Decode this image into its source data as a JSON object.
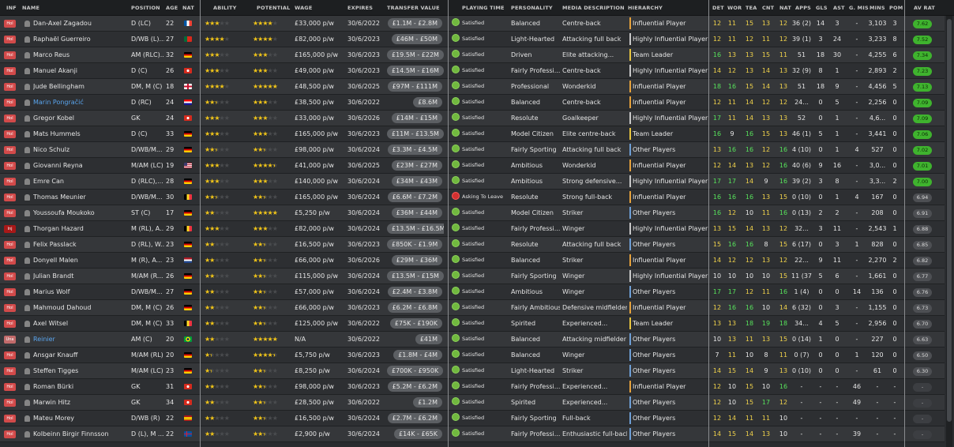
{
  "columns": {
    "inf": "INF",
    "name": "NAME",
    "position": "POSITION",
    "age": "AGE",
    "nat": "NAT",
    "ability": "ABILITY",
    "potential": "POTENTIAL",
    "wage": "WAGE",
    "expires": "EXPIRES",
    "transfer_value": "TRANSFER VALUE",
    "playing_time": "PLAYING TIME",
    "personality": "PERSONALITY",
    "media": "MEDIA DESCRIPTION",
    "hierarchy": "HIERARCHY",
    "det": "DET",
    "wor": "WOR",
    "tea": "TEA",
    "cnt": "CNT",
    "nat2": "NAT",
    "apps": "APPS",
    "gls": "GLS",
    "ast": "AST",
    "gmis": "G. MIS",
    "mins": "MINS",
    "pom": "POM",
    "avrat": "AV RAT"
  },
  "colors": {
    "ratingHigh": "#3fb32e",
    "stars": "#f0c419",
    "satisfied": "#71b83f",
    "unhappy": "#d23030",
    "infTag": "#d24a4a",
    "link": "#5aa5ee"
  },
  "players": [
    {
      "inf": "Hol",
      "name": "Dan-Axel Zagadou",
      "pos": "D (LC)",
      "age": "22",
      "flag": "fr",
      "ab": 3,
      "pot": 4,
      "wage": "£33,000 p/w",
      "exp": "30/6/2022",
      "tv": "£1.1M - £2.8M",
      "pt": "Satisfied",
      "pers": "Balanced",
      "media": "Centre-back",
      "hier": "Influential Player",
      "det": "12",
      "wor": "11",
      "tea": "15",
      "cnt": "13",
      "nat": "12",
      "apps": "36 (2)",
      "gls": "14",
      "ast": "3",
      "gmis": "-",
      "mins": "3,103",
      "pom": "3",
      "rat": "7.62",
      "rc": "h"
    },
    {
      "inf": "Hol",
      "name": "Raphaël Guerreiro",
      "pos": "D/WB (L)...",
      "age": "27",
      "flag": "pt",
      "ab": 4,
      "pot": 4,
      "wage": "£82,000 p/w",
      "exp": "30/6/2023",
      "tv": "£46M - £50M",
      "pt": "Satisfied",
      "pers": "Light-Hearted",
      "media": "Attacking full back",
      "hier": "Highly Influential Player",
      "det": "12",
      "wor": "11",
      "tea": "12",
      "cnt": "11",
      "nat": "12",
      "apps": "39 (1)",
      "gls": "3",
      "ast": "24",
      "gmis": "-",
      "mins": "3,233",
      "pom": "8",
      "rat": "7.52",
      "rc": "h"
    },
    {
      "inf": "Hol",
      "name": "Marco Reus",
      "pos": "AM (RLC)...",
      "age": "32",
      "flag": "de",
      "ab": 3,
      "pot": 3,
      "wage": "£165,000 p/w",
      "exp": "30/6/2023",
      "tv": "£19.5M - £22M",
      "pt": "Satisfied",
      "pers": "Driven",
      "media": "Elite attacking...",
      "hier": "Team Leader",
      "det": "16",
      "wor": "13",
      "tea": "13",
      "cnt": "15",
      "nat": "11",
      "apps": "51",
      "gls": "18",
      "ast": "30",
      "gmis": "-",
      "mins": "4,255",
      "pom": "6",
      "rat": "7.34",
      "rc": "h"
    },
    {
      "inf": "Hol",
      "name": "Manuel Akanji",
      "pos": "D (C)",
      "age": "26",
      "flag": "ch",
      "ab": 3,
      "pot": 3,
      "wage": "£49,000 p/w",
      "exp": "30/6/2023",
      "tv": "£14.5M - £16M",
      "pt": "Satisfied",
      "pers": "Fairly Professi...",
      "media": "Centre-back",
      "hier": "Highly Influential Player",
      "det": "14",
      "wor": "12",
      "tea": "13",
      "cnt": "14",
      "nat": "13",
      "apps": "32 (9)",
      "gls": "8",
      "ast": "1",
      "gmis": "-",
      "mins": "2,893",
      "pom": "2",
      "rat": "7.23",
      "rc": "h"
    },
    {
      "inf": "Hol",
      "name": "Jude Bellingham",
      "pos": "DM, M (C)",
      "age": "18",
      "flag": "gb",
      "ab": 4,
      "pot": 5,
      "wage": "£48,500 p/w",
      "exp": "30/6/2025",
      "tv": "£97M - £111M",
      "pt": "Satisfied",
      "pers": "Professional",
      "media": "Wonderkid",
      "hier": "Influential Player",
      "det": "18",
      "wor": "16",
      "tea": "15",
      "cnt": "14",
      "nat": "13",
      "apps": "51",
      "gls": "18",
      "ast": "9",
      "gmis": "-",
      "mins": "4,456",
      "pom": "5",
      "rat": "7.13",
      "rc": "h"
    },
    {
      "inf": "Hol",
      "name": "Marin Pongračić",
      "pos": "D (RC)",
      "age": "24",
      "flag": "hr",
      "ab": 2.5,
      "pot": 3,
      "wage": "£38,500 p/w",
      "exp": "30/6/2022",
      "tv": "£8.6M",
      "pt": "Satisfied",
      "pers": "Balanced",
      "media": "Centre-back",
      "hier": "Influential Player",
      "det": "12",
      "wor": "11",
      "tea": "14",
      "cnt": "12",
      "nat": "12",
      "apps": "24...",
      "gls": "0",
      "ast": "5",
      "gmis": "-",
      "mins": "2,256",
      "pom": "0",
      "rat": "7.09",
      "rc": "h",
      "link": true
    },
    {
      "inf": "Hol",
      "name": "Gregor Kobel",
      "pos": "GK",
      "age": "24",
      "flag": "ch",
      "ab": 3,
      "pot": 3,
      "wage": "£33,000 p/w",
      "exp": "30/6/2026",
      "tv": "£14M - £15M",
      "pt": "Satisfied",
      "pers": "Resolute",
      "media": "Goalkeeper",
      "hier": "Highly Influential Player",
      "det": "17",
      "wor": "11",
      "tea": "14",
      "cnt": "13",
      "nat": "13",
      "apps": "52",
      "gls": "0",
      "ast": "1",
      "gmis": "-",
      "mins": "4,6...",
      "pom": "0",
      "rat": "7.09",
      "rc": "h"
    },
    {
      "inf": "Hol",
      "name": "Mats Hummels",
      "pos": "D (C)",
      "age": "33",
      "flag": "de",
      "ab": 3,
      "pot": 3,
      "wage": "£165,000 p/w",
      "exp": "30/6/2023",
      "tv": "£11M - £13.5M",
      "pt": "Satisfied",
      "pers": "Model Citizen",
      "media": "Elite centre-back",
      "hier": "Team Leader",
      "det": "16",
      "wor": "9",
      "tea": "16",
      "cnt": "15",
      "nat": "13",
      "apps": "46 (1)",
      "gls": "5",
      "ast": "1",
      "gmis": "-",
      "mins": "3,441",
      "pom": "0",
      "rat": "7.06",
      "rc": "h"
    },
    {
      "inf": "Hol",
      "name": "Nico Schulz",
      "pos": "D/WB/M...",
      "age": "29",
      "flag": "de",
      "ab": 2.5,
      "pot": 2.5,
      "wage": "£98,000 p/w",
      "exp": "30/6/2024",
      "tv": "£3.3M - £4.5M",
      "pt": "Satisfied",
      "pers": "Fairly Sporting",
      "media": "Attacking full back",
      "hier": "Other Players",
      "det": "13",
      "wor": "16",
      "tea": "16",
      "cnt": "12",
      "nat": "16",
      "apps": "4 (10)",
      "gls": "0",
      "ast": "1",
      "gmis": "4",
      "mins": "527",
      "pom": "0",
      "rat": "7.02",
      "rc": "h"
    },
    {
      "inf": "Hol",
      "name": "Giovanni Reyna",
      "pos": "M/AM (LC)",
      "age": "19",
      "flag": "us",
      "ab": 3,
      "pot": 4.5,
      "wage": "£41,000 p/w",
      "exp": "30/6/2025",
      "tv": "£23M - £27M",
      "pt": "Satisfied",
      "pers": "Ambitious",
      "media": "Wonderkid",
      "hier": "Influential Player",
      "det": "12",
      "wor": "14",
      "tea": "13",
      "cnt": "12",
      "nat": "16",
      "apps": "40 (6)",
      "gls": "9",
      "ast": "16",
      "gmis": "-",
      "mins": "3,0...",
      "pom": "0",
      "rat": "7.01",
      "rc": "h"
    },
    {
      "inf": "Hol",
      "name": "Emre Can",
      "pos": "D (RLC),...",
      "age": "28",
      "flag": "de",
      "ab": 3,
      "pot": 3,
      "wage": "£140,000 p/w",
      "exp": "30/6/2024",
      "tv": "£34M - £43M",
      "pt": "Satisfied",
      "pers": "Ambitious",
      "media": "Strong defensive...",
      "hier": "Highly Influential Player",
      "det": "17",
      "wor": "17",
      "tea": "14",
      "cnt": "9",
      "nat": "16",
      "apps": "39 (2)",
      "gls": "3",
      "ast": "8",
      "gmis": "-",
      "mins": "3,3...",
      "pom": "2",
      "rat": "7.00",
      "rc": "h"
    },
    {
      "inf": "Hol",
      "name": "Thomas Meunier",
      "pos": "D/WB/M...",
      "age": "30",
      "flag": "be",
      "ab": 2.5,
      "pot": 2.5,
      "wage": "£165,000 p/w",
      "exp": "30/6/2024",
      "tv": "£6.6M - £7.2M",
      "pt": "Asking To Leave",
      "bad": true,
      "pers": "Resolute",
      "media": "Strong full-back",
      "hier": "Influential Player",
      "det": "16",
      "wor": "16",
      "tea": "16",
      "cnt": "13",
      "nat": "15",
      "apps": "0 (10)",
      "gls": "0",
      "ast": "1",
      "gmis": "4",
      "mins": "167",
      "pom": "0",
      "rat": "6.94",
      "rc": "m"
    },
    {
      "inf": "Hol",
      "name": "Youssoufa Moukoko",
      "pos": "ST (C)",
      "age": "17",
      "flag": "de",
      "ab": 2,
      "pot": 5,
      "wage": "£5,250 p/w",
      "exp": "30/6/2024",
      "tv": "£36M - £44M",
      "pt": "Satisfied",
      "pers": "Model Citizen",
      "media": "Striker",
      "hier": "Other Players",
      "det": "16",
      "wor": "12",
      "tea": "10",
      "cnt": "11",
      "nat": "16",
      "apps": "0 (13)",
      "gls": "2",
      "ast": "2",
      "gmis": "-",
      "mins": "208",
      "pom": "0",
      "rat": "6.91",
      "rc": "m"
    },
    {
      "inf": "Inj",
      "name": "Thorgan Hazard",
      "pos": "M (RL), A...",
      "age": "29",
      "flag": "be",
      "ab": 3,
      "pot": 3,
      "wage": "£82,000 p/w",
      "exp": "30/6/2024",
      "tv": "£13.5M - £16.5M",
      "pt": "Satisfied",
      "pers": "Fairly Professi...",
      "media": "Winger",
      "hier": "Highly Influential Player",
      "det": "13",
      "wor": "15",
      "tea": "14",
      "cnt": "13",
      "nat": "12",
      "apps": "32...",
      "gls": "3",
      "ast": "11",
      "gmis": "-",
      "mins": "2,543",
      "pom": "1",
      "rat": "6.88",
      "rc": "m"
    },
    {
      "inf": "Hol",
      "name": "Felix Passlack",
      "pos": "D (RL), W...",
      "age": "23",
      "flag": "de",
      "ab": 2,
      "pot": 2.5,
      "wage": "£16,500 p/w",
      "exp": "30/6/2023",
      "tv": "£850K - £1.9M",
      "pt": "Satisfied",
      "pers": "Resolute",
      "media": "Attacking full back",
      "hier": "Other Players",
      "det": "15",
      "wor": "16",
      "tea": "16",
      "cnt": "8",
      "nat": "15",
      "apps": "6 (17)",
      "gls": "0",
      "ast": "3",
      "gmis": "1",
      "mins": "828",
      "pom": "0",
      "rat": "6.85",
      "rc": "m"
    },
    {
      "inf": "Hol",
      "name": "Donyell Malen",
      "pos": "M (R), A...",
      "age": "23",
      "flag": "nl",
      "ab": 2,
      "pot": 2.5,
      "wage": "£66,000 p/w",
      "exp": "30/6/2026",
      "tv": "£29M - £36M",
      "pt": "Satisfied",
      "pers": "Balanced",
      "media": "Striker",
      "hier": "Influential Player",
      "det": "14",
      "wor": "12",
      "tea": "12",
      "cnt": "13",
      "nat": "12",
      "apps": "22...",
      "gls": "9",
      "ast": "11",
      "gmis": "-",
      "mins": "2,270",
      "pom": "2",
      "rat": "6.82",
      "rc": "m"
    },
    {
      "inf": "Hol",
      "name": "Julian Brandt",
      "pos": "M/AM (R...",
      "age": "26",
      "flag": "de",
      "ab": 2,
      "pot": 2.5,
      "wage": "£115,000 p/w",
      "exp": "30/6/2024",
      "tv": "£13.5M - £15M",
      "pt": "Satisfied",
      "pers": "Fairly Sporting",
      "media": "Winger",
      "hier": "Highly Influential Player",
      "det": "10",
      "wor": "10",
      "tea": "10",
      "cnt": "10",
      "nat": "15",
      "apps": "11 (37)",
      "gls": "5",
      "ast": "6",
      "gmis": "-",
      "mins": "1,661",
      "pom": "0",
      "rat": "6.77",
      "rc": "m"
    },
    {
      "inf": "Hol",
      "name": "Marius Wolf",
      "pos": "D/WB/M...",
      "age": "27",
      "flag": "de",
      "ab": 2,
      "pot": 2.5,
      "wage": "£57,000 p/w",
      "exp": "30/6/2024",
      "tv": "£2.4M - £3.8M",
      "pt": "Satisfied",
      "pers": "Ambitious",
      "media": "Winger",
      "hier": "Other Players",
      "det": "17",
      "wor": "17",
      "tea": "12",
      "cnt": "11",
      "nat": "16",
      "apps": "1 (4)",
      "gls": "0",
      "ast": "0",
      "gmis": "14",
      "mins": "136",
      "pom": "0",
      "rat": "6.76",
      "rc": "m"
    },
    {
      "inf": "Hol",
      "name": "Mahmoud Dahoud",
      "pos": "DM, M (C)",
      "age": "26",
      "flag": "de",
      "ab": 2,
      "pot": 2.5,
      "wage": "£66,000 p/w",
      "exp": "30/6/2023",
      "tv": "£6.2M - £6.8M",
      "pt": "Satisfied",
      "pers": "Fairly Ambitious",
      "media": "Defensive midfielder",
      "hier": "Influential Player",
      "det": "12",
      "wor": "16",
      "tea": "16",
      "cnt": "10",
      "nat": "14",
      "apps": "6 (32)",
      "gls": "0",
      "ast": "3",
      "gmis": "-",
      "mins": "1,155",
      "pom": "0",
      "rat": "6.73",
      "rc": "m"
    },
    {
      "inf": "Hol",
      "name": "Axel Witsel",
      "pos": "DM, M (C)",
      "age": "33",
      "flag": "be",
      "ab": 2,
      "pot": 2.5,
      "wage": "£125,000 p/w",
      "exp": "30/6/2022",
      "tv": "£75K - £190K",
      "pt": "Satisfied",
      "pers": "Spirited",
      "media": "Experienced...",
      "hier": "Team Leader",
      "det": "13",
      "wor": "13",
      "tea": "18",
      "cnt": "19",
      "nat": "18",
      "apps": "34...",
      "gls": "4",
      "ast": "5",
      "gmis": "-",
      "mins": "2,956",
      "pom": "0",
      "rat": "6.70",
      "rc": "m"
    },
    {
      "inf": "Una",
      "name": "Reinier",
      "pos": "AM (C)",
      "age": "20",
      "flag": "br",
      "ab": 2,
      "pot": 5,
      "wage": "N/A",
      "exp": "30/6/2022",
      "tv": "£41M",
      "pt": "Satisfied",
      "pers": "Balanced",
      "media": "Attacking midfielder",
      "hier": "Other Players",
      "det": "10",
      "wor": "13",
      "tea": "11",
      "cnt": "13",
      "nat": "15",
      "apps": "0 (14)",
      "gls": "1",
      "ast": "0",
      "gmis": "-",
      "mins": "227",
      "pom": "0",
      "rat": "6.63",
      "rc": "m",
      "link": true
    },
    {
      "inf": "Hol",
      "name": "Ansgar Knauff",
      "pos": "M/AM (RL)",
      "age": "20",
      "flag": "de",
      "ab": 1.5,
      "pot": 4.5,
      "wage": "£5,750 p/w",
      "exp": "30/6/2023",
      "tv": "£1.8M - £4M",
      "pt": "Satisfied",
      "pers": "Balanced",
      "media": "Winger",
      "hier": "Other Players",
      "det": "7",
      "wor": "11",
      "tea": "10",
      "cnt": "8",
      "nat": "11",
      "apps": "0 (7)",
      "gls": "0",
      "ast": "0",
      "gmis": "1",
      "mins": "120",
      "pom": "0",
      "rat": "6.50",
      "rc": "m"
    },
    {
      "inf": "Hol",
      "name": "Steffen Tigges",
      "pos": "M/AM (LC)",
      "age": "23",
      "flag": "de",
      "ab": 1.5,
      "pot": 2.5,
      "wage": "£8,250 p/w",
      "exp": "30/6/2024",
      "tv": "£700K - £950K",
      "pt": "Satisfied",
      "pers": "Light-Hearted",
      "media": "Striker",
      "hier": "Other Players",
      "det": "14",
      "wor": "15",
      "tea": "14",
      "cnt": "9",
      "nat": "13",
      "apps": "0 (10)",
      "gls": "0",
      "ast": "0",
      "gmis": "-",
      "mins": "61",
      "pom": "0",
      "rat": "6.30",
      "rc": "m"
    },
    {
      "inf": "Hol",
      "name": "Roman Bürki",
      "pos": "GK",
      "age": "31",
      "flag": "ch",
      "ab": 2,
      "pot": 2.5,
      "wage": "£98,000 p/w",
      "exp": "30/6/2023",
      "tv": "£5.2M - £6.2M",
      "pt": "Satisfied",
      "pers": "Fairly Professi...",
      "media": "Experienced...",
      "hier": "Influential Player",
      "det": "12",
      "wor": "10",
      "tea": "15",
      "cnt": "10",
      "nat": "16",
      "apps": "-",
      "gls": "-",
      "ast": "-",
      "gmis": "46",
      "mins": "-",
      "pom": "-",
      "rat": "-",
      "rc": "n"
    },
    {
      "inf": "Hol",
      "name": "Marwin Hitz",
      "pos": "GK",
      "age": "34",
      "flag": "ch",
      "ab": 2,
      "pot": 2.5,
      "wage": "£28,500 p/w",
      "exp": "30/6/2022",
      "tv": "£1.2M",
      "pt": "Satisfied",
      "pers": "Spirited",
      "media": "Experienced...",
      "hier": "Other Players",
      "det": "12",
      "wor": "10",
      "tea": "15",
      "cnt": "17",
      "nat": "12",
      "apps": "-",
      "gls": "-",
      "ast": "-",
      "gmis": "49",
      "mins": "-",
      "pom": "-",
      "rat": "-",
      "rc": "n"
    },
    {
      "inf": "Hol",
      "name": "Mateu Morey",
      "pos": "D/WB (R)",
      "age": "22",
      "flag": "es",
      "ab": 2,
      "pot": 2.5,
      "wage": "£16,500 p/w",
      "exp": "30/6/2024",
      "tv": "£2.7M - £6.2M",
      "pt": "Satisfied",
      "pers": "Fairly Sporting",
      "media": "Full-back",
      "hier": "Other Players",
      "det": "12",
      "wor": "14",
      "tea": "11",
      "cnt": "11",
      "nat": "10",
      "apps": "-",
      "gls": "-",
      "ast": "-",
      "gmis": "-",
      "mins": "-",
      "pom": "-",
      "rat": "-",
      "rc": "n"
    },
    {
      "inf": "Hol",
      "name": "Kolbeinn Birgir Finnsson",
      "pos": "D (L), M ...",
      "age": "22",
      "flag": "is",
      "ab": 2,
      "pot": 2.5,
      "wage": "£2,900 p/w",
      "exp": "30/6/2024",
      "tv": "£14K - £65K",
      "pt": "Satisfied",
      "pers": "Fairly Professi...",
      "media": "Enthusiastic full-back",
      "hier": "Other Players",
      "det": "14",
      "wor": "15",
      "tea": "14",
      "cnt": "13",
      "nat": "10",
      "apps": "-",
      "gls": "-",
      "ast": "-",
      "gmis": "39",
      "mins": "-",
      "pom": "-",
      "rat": "-",
      "rc": "n"
    }
  ]
}
